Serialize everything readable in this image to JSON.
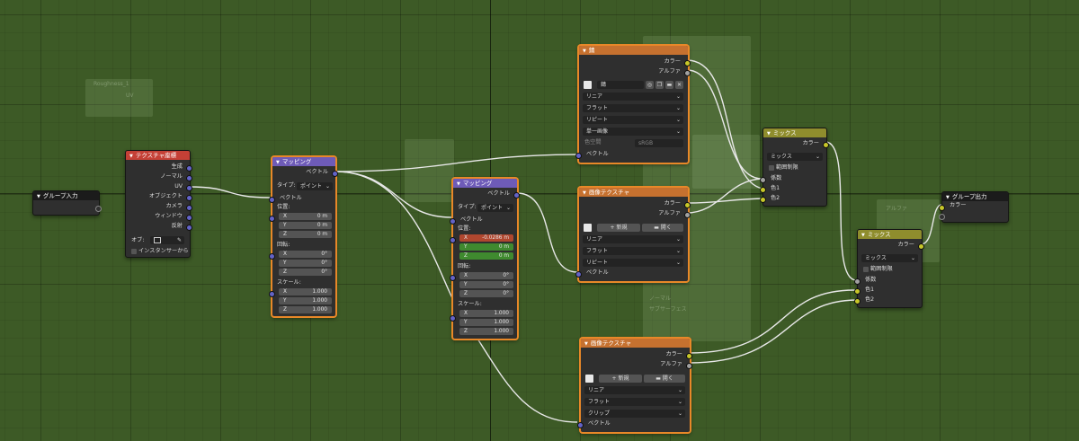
{
  "nodes": {
    "group_input": {
      "title": "グループ入力"
    },
    "tex_coord": {
      "title": "テクスチャ座標",
      "outputs": [
        "生成",
        "ノーマル",
        "UV",
        "オブジェクト",
        "カメラ",
        "ウィンドウ",
        "反射"
      ],
      "object_label": "オブ:",
      "instancer_label": "インスタンサーから"
    },
    "mapping1": {
      "title": "マッピング",
      "output": "ベクトル",
      "type_label": "タイプ:",
      "type_value": "ポイント",
      "input": "ベクトル",
      "location_label": "位置:",
      "location": [
        {
          "k": "X",
          "v": "0 m"
        },
        {
          "k": "Y",
          "v": "0 m"
        },
        {
          "k": "Z",
          "v": "0 m"
        }
      ],
      "rotation_label": "回転:",
      "rotation": [
        {
          "k": "X",
          "v": "0°"
        },
        {
          "k": "Y",
          "v": "0°"
        },
        {
          "k": "Z",
          "v": "0°"
        }
      ],
      "scale_label": "スケール:",
      "scale": [
        {
          "k": "X",
          "v": "1.000"
        },
        {
          "k": "Y",
          "v": "1.000"
        },
        {
          "k": "Z",
          "v": "1.000"
        }
      ]
    },
    "mapping2": {
      "title": "マッピング",
      "output": "ベクトル",
      "type_label": "タイプ:",
      "type_value": "ポイント",
      "input": "ベクトル",
      "location_label": "位置:",
      "location": [
        {
          "k": "X",
          "v": "-0.0286 m"
        },
        {
          "k": "Y",
          "v": "0 m"
        },
        {
          "k": "Z",
          "v": "0 m"
        }
      ],
      "rotation_label": "回転:",
      "rotation": [
        {
          "k": "X",
          "v": "0°"
        },
        {
          "k": "Y",
          "v": "0°"
        },
        {
          "k": "Z",
          "v": "0°"
        }
      ],
      "scale_label": "スケール:",
      "scale": [
        {
          "k": "X",
          "v": "1.000"
        },
        {
          "k": "Y",
          "v": "1.000"
        },
        {
          "k": "Z",
          "v": "1.000"
        }
      ]
    },
    "image1": {
      "title": "錆",
      "out_color": "カラー",
      "out_alpha": "アルファ",
      "image_name": "錆",
      "interp": "リニア",
      "projection": "フラット",
      "extension": "リピート",
      "source": "単一画像",
      "colorspace_label": "色空間",
      "colorspace_value": "sRGB",
      "input": "ベクトル"
    },
    "image2": {
      "title": "画像テクスチャ",
      "out_color": "カラー",
      "out_alpha": "アルファ",
      "new_label": "新規",
      "open_label": "開く",
      "interp": "リニア",
      "projection": "フラット",
      "extension": "リピート",
      "input": "ベクトル"
    },
    "image3": {
      "title": "画像テクスチャ",
      "out_color": "カラー",
      "out_alpha": "アルファ",
      "new_label": "新規",
      "open_label": "開く",
      "interp": "リニア",
      "projection": "フラット",
      "extension": "クリップ",
      "input": "ベクトル"
    },
    "mix1": {
      "title": "ミックス",
      "output": "カラー",
      "blend": "ミックス",
      "clamp_label": "範囲制限",
      "in_fac": "係数",
      "in_c1": "色1",
      "in_c2": "色2"
    },
    "mix2": {
      "title": "ミックス",
      "output": "カラー",
      "blend": "ミックス",
      "clamp_label": "範囲制限",
      "in_fac": "係数",
      "in_c1": "色1",
      "in_c2": "色2"
    },
    "group_output": {
      "title": "グループ出力",
      "input": "カラー"
    }
  },
  "background": {
    "ghost_labels": [
      "Roughness_1",
      "UV",
      "ノーマル",
      "アルファ",
      "サブサーフェス"
    ]
  },
  "colors": {
    "vector_socket": "#6363c7",
    "color_socket": "#c7c729",
    "float_socket": "#a1a1a1",
    "selected_outline": "#e88828",
    "texture_header": "#c54036",
    "vector_header": "#6e5bb8",
    "image_header": "#c6712f",
    "mix_header": "#8f8d2d",
    "group_header": "#1b1b1b"
  }
}
